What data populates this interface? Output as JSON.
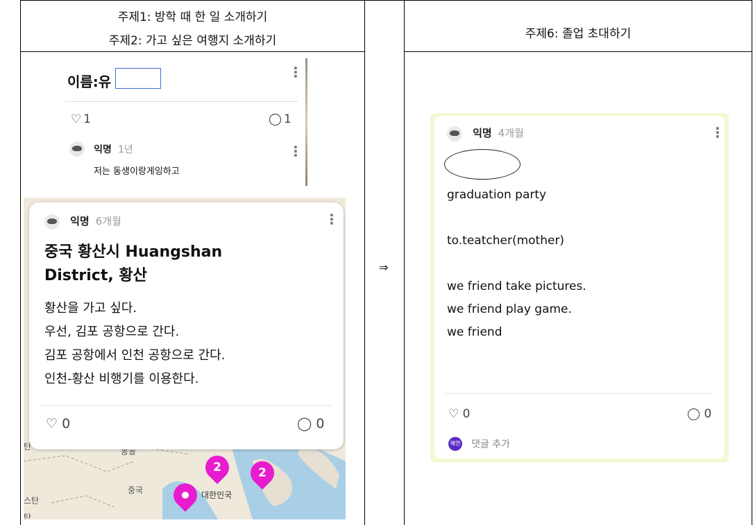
{
  "headers": {
    "left_line1": "주제1: 방학 때 한 일 소개하기",
    "left_line2": "주제2: 가고 싶은 여행지 소개하기",
    "right": "주제6: 졸업 초대하기",
    "arrow": "⇒"
  },
  "top_card": {
    "title": "이름:유",
    "likes_icon": "heart-icon",
    "likes": "1",
    "comments_icon": "comment-icon",
    "comments": "1",
    "comment": {
      "author": "익명",
      "time": "1년",
      "text": "저는 동생이랑게잉하고"
    }
  },
  "map_card": {
    "author": "익명",
    "time": "6개월",
    "title_line1": "중국 황산시 Huangshan",
    "title_line2": "District, 황산",
    "body": [
      "황산을 가고 싶다.",
      "우선, 김포 공항으로 간다.",
      "김포 공항에서 인천 공항으로 간다.",
      "인천-황산 비행기를 이용한다."
    ],
    "likes": "0",
    "comments": "0"
  },
  "map": {
    "labels": {
      "korea": "대한민국",
      "china": "중국",
      "partial1": "탄",
      "partial2": "스탄",
      "partial3": "탄",
      "partial4": "몽골"
    },
    "pins": [
      {
        "count": "2"
      },
      {
        "count": "2"
      },
      {
        "count": ""
      }
    ],
    "colors": {
      "pin": "#e81ccf",
      "land": "#efe9dc",
      "sea": "#a9cfe6"
    }
  },
  "right_card": {
    "author": "익명",
    "time": "4개월",
    "lines": [
      "graduation party",
      "",
      "to.teatcher(mother)",
      "",
      "we friend take pictures.",
      "we friend play game.",
      "we friend"
    ],
    "likes": "0",
    "comments": "0",
    "commenter_badge": "혜연",
    "add_comment": "댓글 추가",
    "bg_color": "#f3f8d6"
  }
}
